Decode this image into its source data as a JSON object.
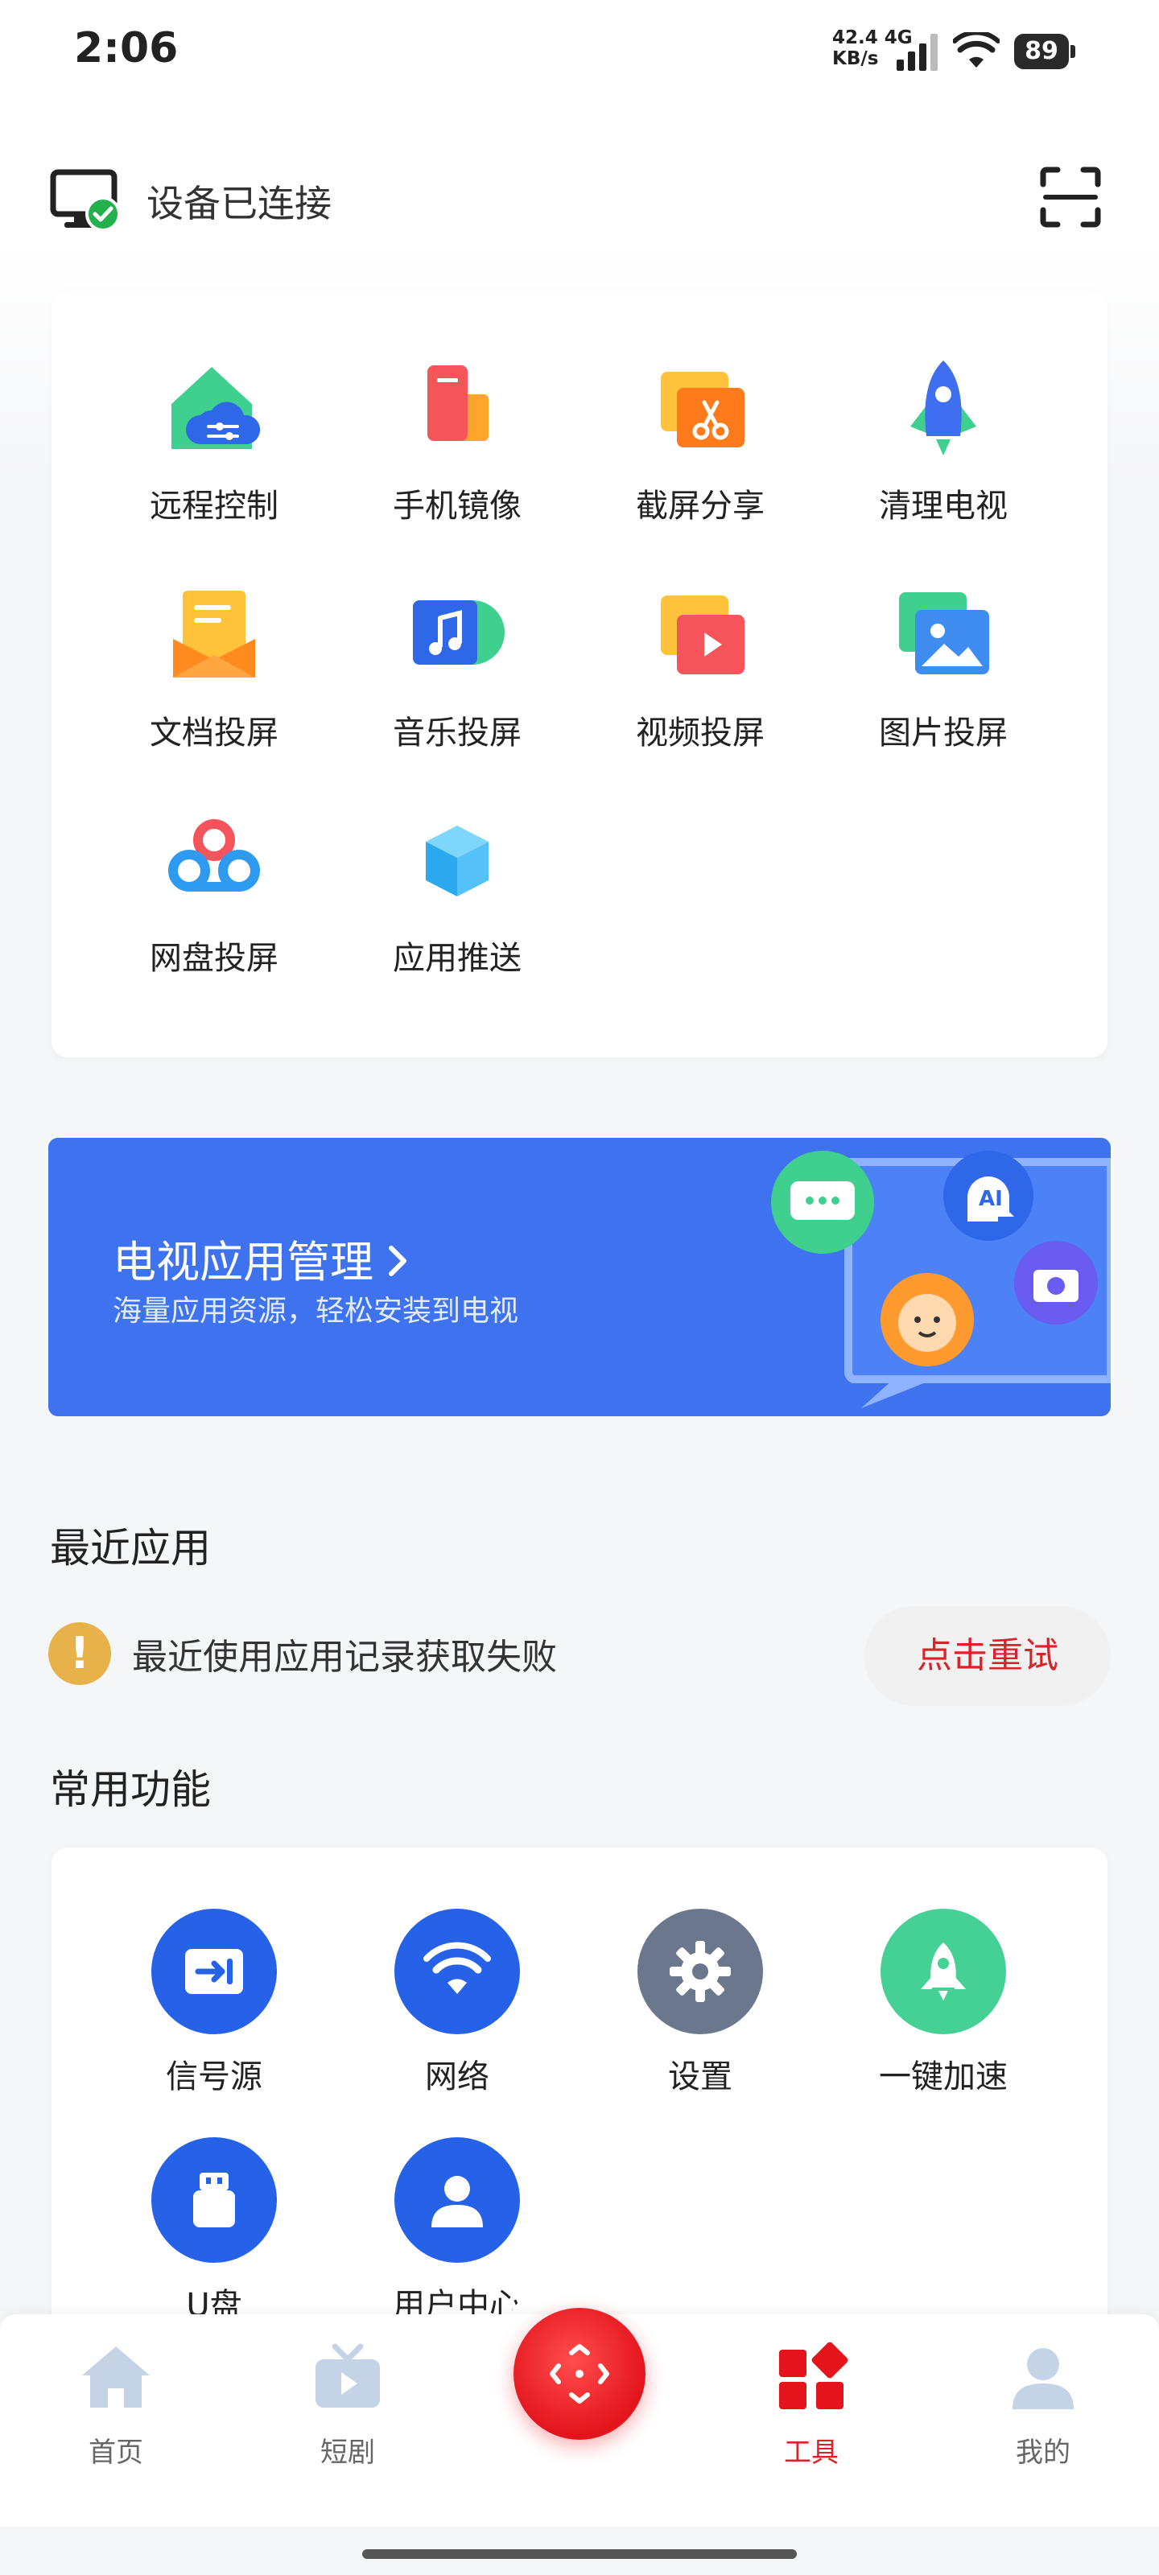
{
  "status_bar": {
    "time": "2:06",
    "net_speed_value": "42.4 4G",
    "net_speed_unit": "KB/s",
    "battery": "89"
  },
  "header": {
    "device_status": "设备已连接",
    "scan_icon": "scan-icon"
  },
  "tools": [
    {
      "label": "远程控制",
      "icon": "remote-control-icon"
    },
    {
      "label": "手机镜像",
      "icon": "phone-mirror-icon"
    },
    {
      "label": "截屏分享",
      "icon": "screenshot-share-icon"
    },
    {
      "label": "清理电视",
      "icon": "clean-tv-icon"
    },
    {
      "label": "文档投屏",
      "icon": "document-cast-icon"
    },
    {
      "label": "音乐投屏",
      "icon": "music-cast-icon"
    },
    {
      "label": "视频投屏",
      "icon": "video-cast-icon"
    },
    {
      "label": "图片投屏",
      "icon": "image-cast-icon"
    },
    {
      "label": "网盘投屏",
      "icon": "cloud-drive-cast-icon"
    },
    {
      "label": "应用推送",
      "icon": "app-push-icon"
    }
  ],
  "banner": {
    "title": "电视应用管理",
    "subtitle": "海量应用资源，轻松安装到电视",
    "badge_ai": "AI",
    "colors": {
      "background": "#3f72ee"
    }
  },
  "recent": {
    "title": "最近应用",
    "error_text": "最近使用应用记录获取失败",
    "warning_mark": "!",
    "retry_label": "点击重试"
  },
  "common": {
    "title": "常用功能",
    "items": [
      {
        "label": "信号源",
        "icon": "signal-source-icon",
        "color": "#2562e8"
      },
      {
        "label": "网络",
        "icon": "wifi-icon",
        "color": "#2562e8"
      },
      {
        "label": "设置",
        "icon": "gear-icon",
        "color": "#6b778c"
      },
      {
        "label": "一键加速",
        "icon": "rocket-icon",
        "color": "#45d196"
      },
      {
        "label": "U盘",
        "icon": "usb-drive-icon",
        "color": "#2562e8"
      },
      {
        "label": "用户中心",
        "icon": "user-icon",
        "color": "#2562e8"
      }
    ]
  },
  "bottom_nav": {
    "items": [
      {
        "label": "首页",
        "icon": "home-icon",
        "active": false
      },
      {
        "label": "短剧",
        "icon": "tv-icon",
        "active": false
      },
      {
        "label": "工具",
        "icon": "tools-icon",
        "active": true
      },
      {
        "label": "我的",
        "icon": "profile-icon",
        "active": false
      }
    ],
    "center_icon": "remote-icon",
    "accent": "#d8232a"
  }
}
